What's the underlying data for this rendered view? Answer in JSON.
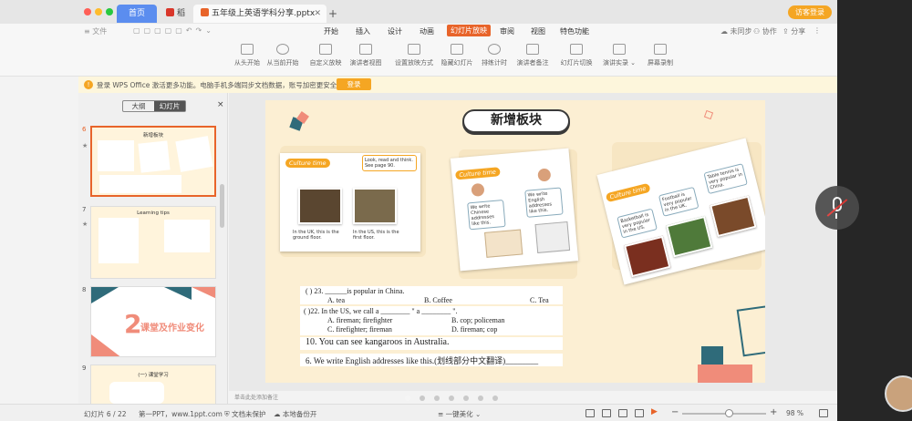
{
  "titlebar": {
    "tabs": [
      {
        "label": "首页"
      },
      {
        "label": "稻壳"
      },
      {
        "label": "五年级上英语学科分享.pptx"
      }
    ],
    "visitor_login": "访客登录"
  },
  "menubar": {
    "file": "文件",
    "items": [
      "开始",
      "插入",
      "设计",
      "动画",
      "幻灯片放映",
      "审阅",
      "视图",
      "特色功能"
    ],
    "active": "幻灯片放映",
    "right": {
      "sync": "未同步",
      "collab": "协作",
      "share": "分享"
    }
  },
  "ribbon": {
    "buttons": [
      "从头开始",
      "从当前开始",
      "自定义放映",
      "演讲者视图",
      "设置放映方式",
      "隐藏幻灯片",
      "排练计时",
      "演讲者备注",
      "幻灯片切换",
      "演讲实录",
      "屏幕录制"
    ]
  },
  "notice": {
    "text": "登录 WPS Office 激活更多功能。电脑手机多端同步文档数据，账号加密更安全。",
    "button": "登录"
  },
  "panel": {
    "tab_outline": "大纲",
    "tab_slides": "幻灯片",
    "close": "×",
    "slides": [
      {
        "num": "6",
        "title": "新增板块"
      },
      {
        "num": "7",
        "title": "Learning tips"
      },
      {
        "num": "8",
        "title": "课堂及作业变化",
        "big_num": "2"
      },
      {
        "num": "9",
        "title": "(一) 课堂学习"
      }
    ]
  },
  "slide": {
    "title": "新增板块",
    "culture_label": "Culture time",
    "card1": {
      "note": "Look, read and think. See page 90.",
      "caption_left": "In the UK, this is the ground floor.",
      "caption_right": "In the US, this is the first floor."
    },
    "card2": {
      "bubble_left": "We write Chinese addresses like this.",
      "bubble_right": "We write English addresses like this."
    },
    "card3": {
      "bubble_left": "Basketball is very popular in the US.",
      "bubble_mid": "Football is very popular in the UK.",
      "bubble_right": "Table tennis is very popular in China."
    },
    "questions": {
      "q23": "(      ) 23. ______is popular in China.",
      "q23_a": "A.  tea",
      "q23_b": "B. Coffee",
      "q23_c": "C. Tea",
      "q22": "(      )22. In the US, we call a ________ \" a ________ \".",
      "q22_a": "A. fireman; firefighter",
      "q22_b": "B. cop; policeman",
      "q22_c": "C. firefighter; fireman",
      "q22_d": "D. fireman; cop",
      "q10": "10. You can see kangaroos in Australia.",
      "q6": "6. We write English addresses like this.(划线部分中文翻译)________"
    },
    "notes_placeholder": "单击此处添加备注"
  },
  "statusbar": {
    "slide_counter": "幻灯片 6 / 22",
    "theme": "第一PPT，www.1ppt.com",
    "protect": "文档未保护",
    "backup": "本地备份开",
    "beautify": "一键美化",
    "zoom": "98 %"
  },
  "colors": {
    "accent": "#e8642a",
    "slide_bg": "#fcefd3",
    "teal": "#2f6b7a",
    "coral": "#f08c7a"
  }
}
